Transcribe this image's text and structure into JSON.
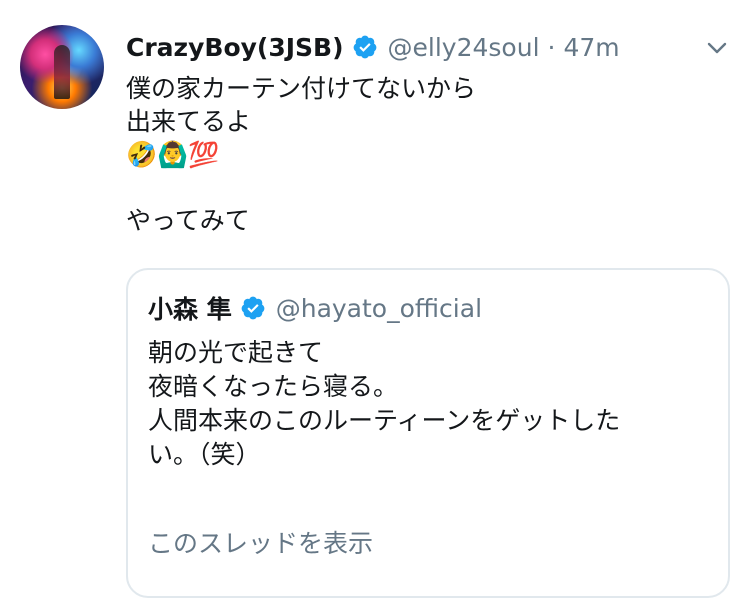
{
  "tweet": {
    "display_name": "CrazyBoy(3JSB)",
    "handle": "@elly24soul",
    "separator": "·",
    "time": "47m",
    "text_lines": [
      "僕の家カーテン付けてないから",
      "出来てるよ"
    ],
    "emoji_line": "🤣🙆‍♂️💯",
    "text_after": "やってみて"
  },
  "quoted_tweet": {
    "display_name": "小森 隼",
    "handle": "@hayato_official",
    "text_lines": [
      "朝の光で起きて",
      "夜暗くなったら寝る。",
      "",
      "人間本来のこのルーティーンをゲットした",
      "い。（笑）"
    ],
    "show_thread": "このスレッドを表示"
  },
  "colors": {
    "verified": "#1da1f2",
    "muted": "#657786",
    "text": "#14171a",
    "border": "#e1e8ed"
  },
  "icons": {
    "verified": "verified-badge-icon",
    "menu": "chevron-down-icon",
    "avatar": "profile-avatar"
  }
}
